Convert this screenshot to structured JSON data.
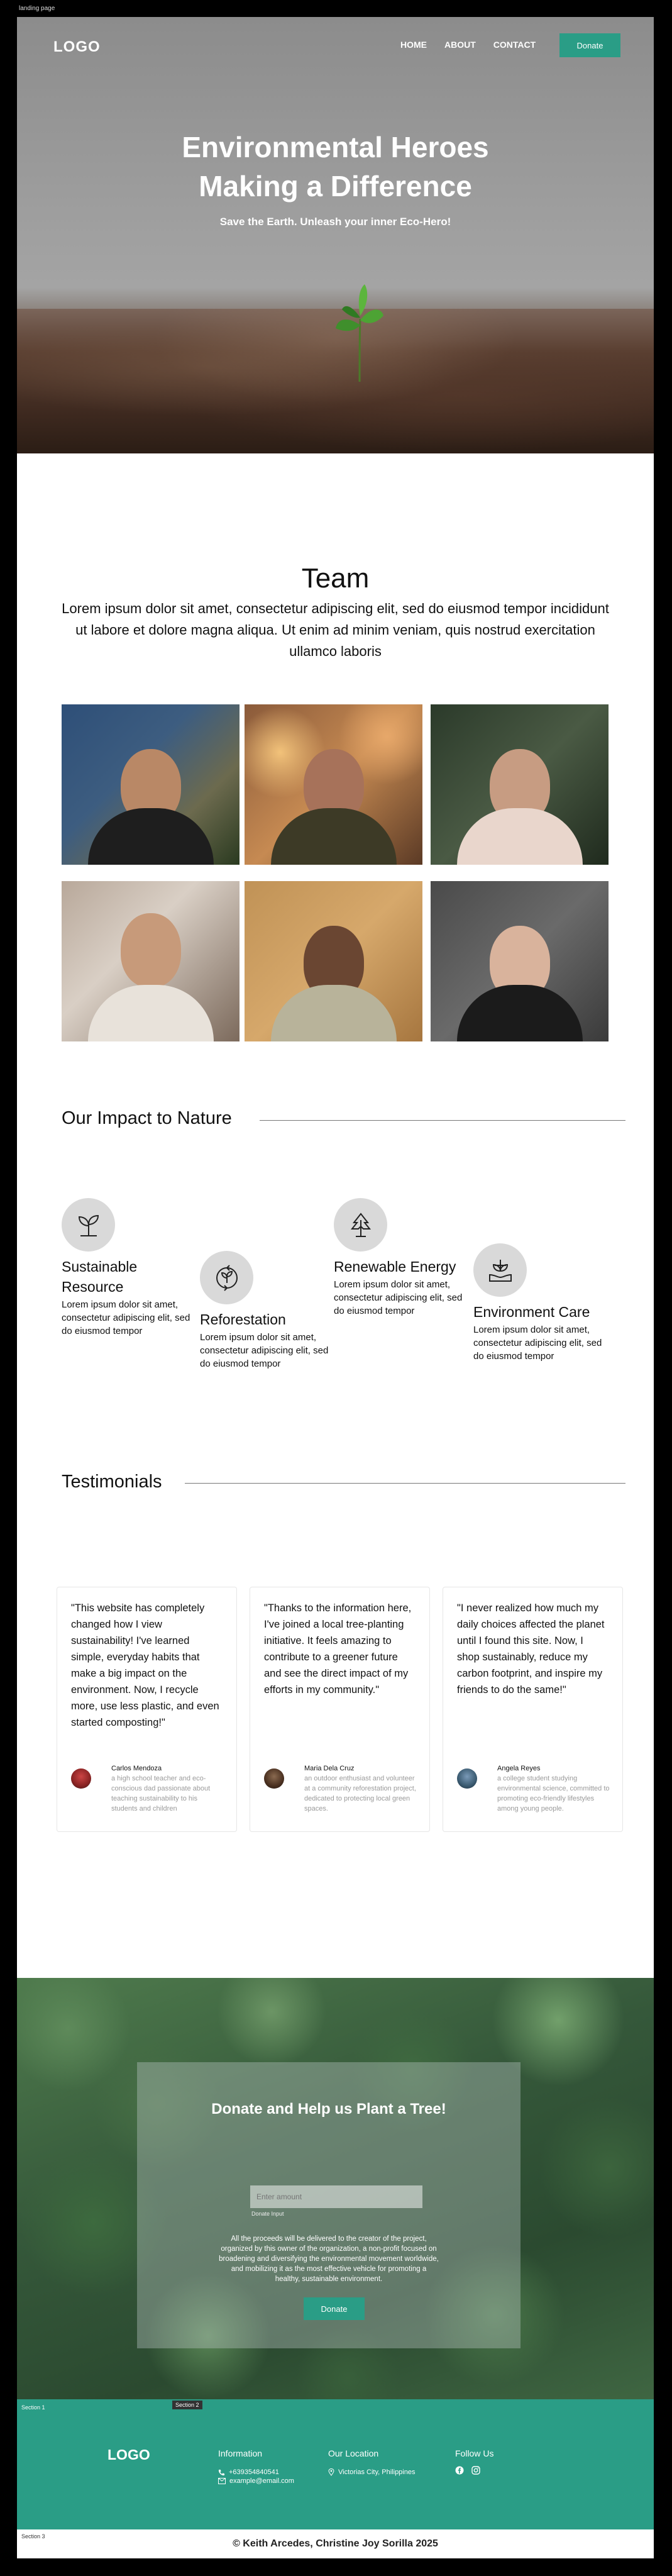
{
  "canvas_label": "landing page",
  "nav": {
    "logo": "LOGO",
    "links": [
      "HOME",
      "ABOUT",
      "CONTACT"
    ],
    "donate_label": "Donate"
  },
  "hero": {
    "title_line1": "Environmental Heroes",
    "title_line2": "Making a Difference",
    "tagline": "Save the Earth. Unleash your inner Eco-Hero!"
  },
  "team": {
    "title": "Team",
    "description": "Lorem ipsum dolor sit amet, consectetur adipiscing elit, sed do eiusmod tempor incididunt ut labore et dolore magna aliqua. Ut enim ad minim veniam, quis nostrud exercitation ullamco laboris"
  },
  "impact": {
    "title": "Our Impact to Nature",
    "items": [
      {
        "title": "Sustainable Resource",
        "text": "Lorem ipsum dolor sit amet, consectetur adipiscing elit, sed do eiusmod tempor",
        "icon": "sprout-icon"
      },
      {
        "title": "Reforestation",
        "text": "Lorem ipsum dolor sit amet, consectetur adipiscing elit, sed do eiusmod tempor",
        "icon": "recycle-icon"
      },
      {
        "title": "Renewable Energy",
        "text": "Lorem ipsum dolor sit amet, consectetur adipiscing elit, sed do eiusmod tempor",
        "icon": "tree-icon"
      },
      {
        "title": "Environment Care",
        "text": "Lorem ipsum dolor sit amet, consectetur adipiscing elit, sed do eiusmod tempor",
        "icon": "hand-leaf-icon"
      }
    ]
  },
  "testimonials": {
    "title": "Testimonials",
    "items": [
      {
        "quote": "\"This website has completely changed how I view sustainability! I've learned simple, everyday habits that make a big impact on the environment. Now, I recycle more, use less plastic, and even started composting!\"",
        "name": "Carlos Mendoza",
        "bio": "a high school teacher and eco-conscious dad passionate about teaching sustainability to his students and children"
      },
      {
        "quote": "\"Thanks to the information here, I've joined a local tree-planting initiative. It feels amazing to contribute to a greener future and see the direct impact of my efforts in my community.\"",
        "name": "Maria Dela Cruz",
        "bio": "an outdoor enthusiast and volunteer at a community reforestation project, dedicated to protecting local green spaces."
      },
      {
        "quote": "\"I never realized how much my daily choices affected the planet until I found this site. Now, I shop sustainably, reduce my carbon footprint, and inspire my friends to do the same!\"",
        "name": "Angela Reyes",
        "bio": "a college student studying environmental science, committed to promoting eco-friendly lifestyles among young people."
      }
    ]
  },
  "donate": {
    "title": "Donate and Help us Plant a Tree!",
    "input_placeholder": "Enter amount",
    "input_label": "Donate Input",
    "note": "All the proceeds will be delivered to the creator of the project, organized by this owner of the organization, a non-profit focused on broadening and diversifying the environmental movement worldwide, and mobilizing it as the most effective vehicle for promoting a healthy, sustainable environment.",
    "button_label": "Donate"
  },
  "footer": {
    "logo": "LOGO",
    "info_title": "Information",
    "phone": "+639354840541",
    "email": "example@email.com",
    "location_title": "Our Location",
    "location": "Victorias City, Philippines",
    "follow_title": "Follow Us",
    "section_tag_1": "Section 1",
    "section_tag_2": "Section 2",
    "section_tag_3": "Section 3"
  },
  "copyright": "© Keith Arcedes, Christine Joy Sorilla 2025",
  "colors": {
    "accent": "#2a9d86"
  }
}
